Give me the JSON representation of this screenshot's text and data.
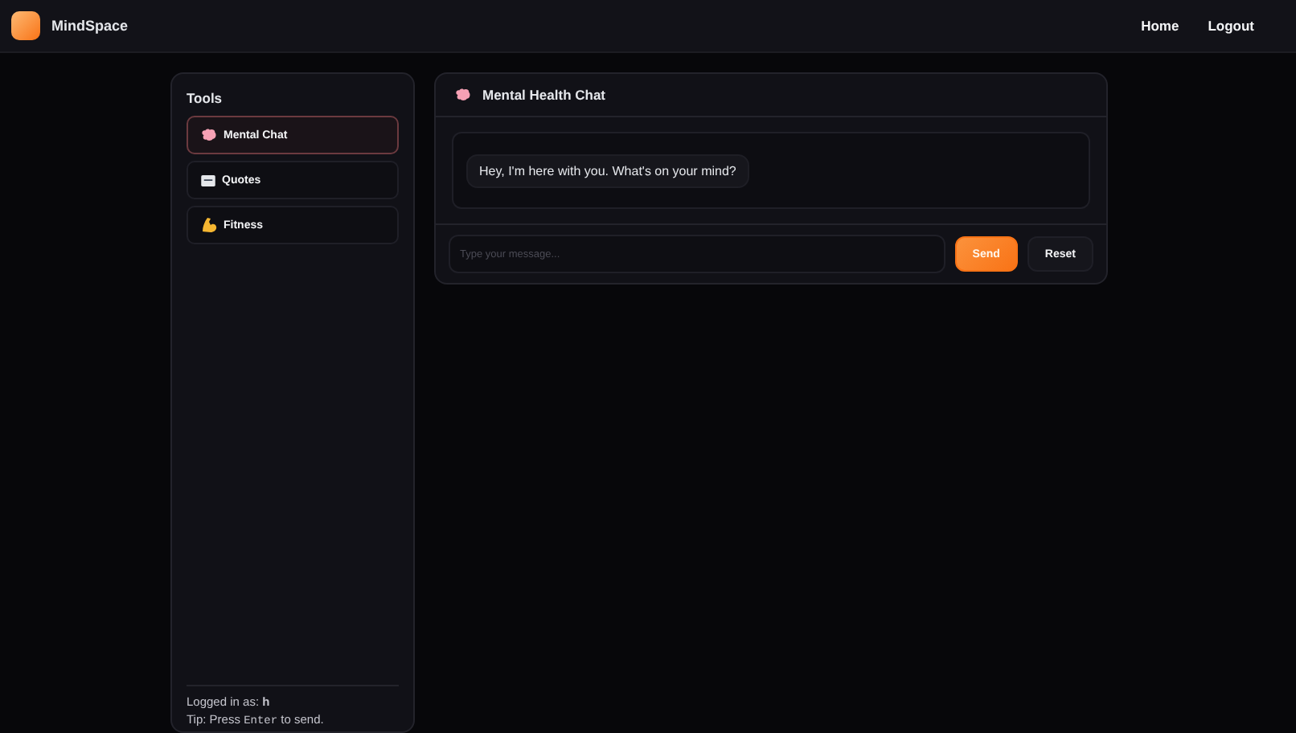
{
  "header": {
    "brand": "MindSpace",
    "nav": [
      {
        "label": "Home"
      },
      {
        "label": "Logout"
      }
    ]
  },
  "sidebar": {
    "title": "Tools",
    "items": [
      {
        "label": "Mental Chat",
        "kind": "brain",
        "selected": true
      },
      {
        "label": "Quotes",
        "kind": "message",
        "selected": false
      },
      {
        "label": "Fitness",
        "kind": "arm",
        "selected": false
      }
    ],
    "logged_in": "Logged in as: **h**",
    "tip": {
      "before": "Tip: Press ",
      "key": "Enter",
      "after": " to send."
    }
  },
  "chat": {
    "title": "Mental Health Chat",
    "messages": [
      {
        "text": "Hey, I'm here with you. What's on your mind?"
      }
    ],
    "input": {
      "placeholder": "Type your message..."
    },
    "buttons": [
      {
        "label": "Send",
        "kind": "primary"
      },
      {
        "label": "Reset",
        "kind": "secondary"
      }
    ]
  }
}
